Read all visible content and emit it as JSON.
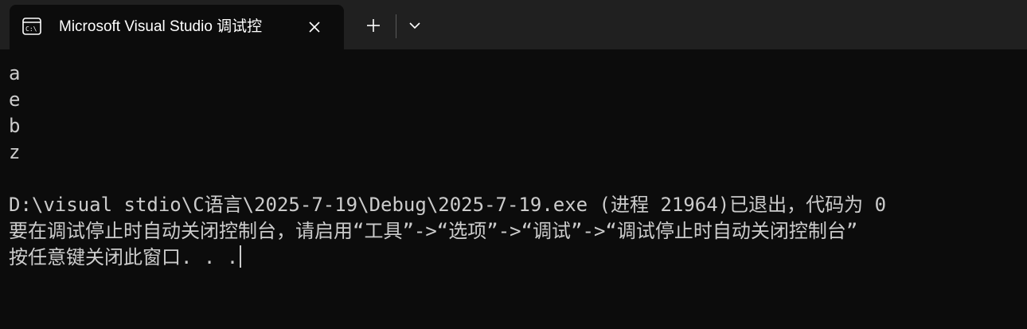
{
  "tab": {
    "title": "Microsoft Visual Studio 调试控",
    "icon": "terminal-icon"
  },
  "tabbar": {
    "new_tab_icon": "plus-icon",
    "dropdown_icon": "chevron-down-icon",
    "close_icon": "close-icon"
  },
  "console": {
    "lines": [
      "a",
      "e",
      "b",
      "z",
      "",
      "D:\\visual stdio\\C语言\\2025-7-19\\Debug\\2025-7-19.exe (进程 21964)已退出，代码为 0",
      "要在调试停止时自动关闭控制台，请启用“工具”->“选项”->“调试”->“调试停止时自动关闭控制台”",
      "按任意键关闭此窗口. . ."
    ]
  },
  "colors": {
    "background": "#0c0c0c",
    "tabbar": "#202020",
    "text": "#cccccc"
  }
}
